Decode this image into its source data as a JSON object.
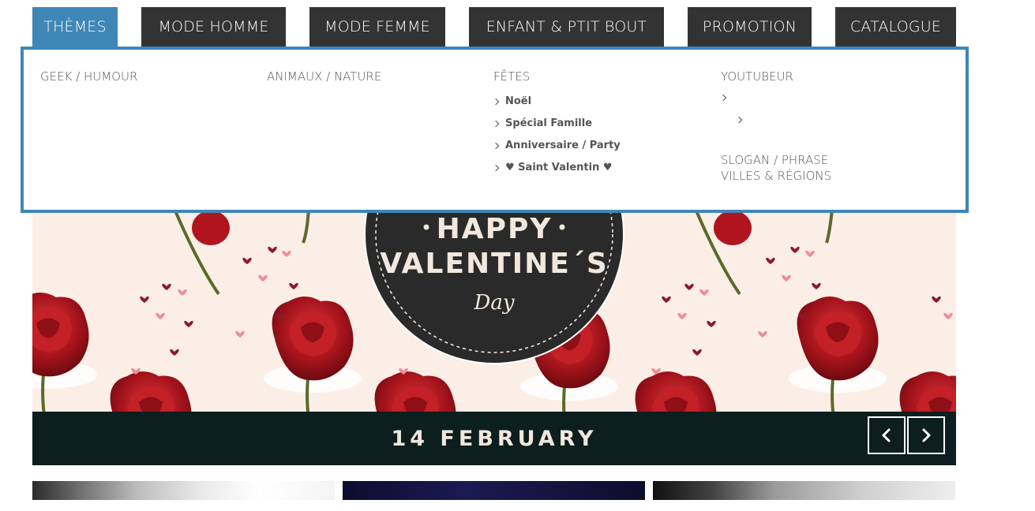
{
  "nav": {
    "tabs": [
      {
        "label": "THÈMES",
        "active": true
      },
      {
        "label": "MODE HOMME"
      },
      {
        "label": "MODE FEMME"
      },
      {
        "label": "ENFANT & PTIT BOUT"
      },
      {
        "label": "PROMOTION"
      },
      {
        "label": "CATALOGUE"
      }
    ]
  },
  "dropdown": {
    "columns": [
      {
        "heading": "GEEK / HUMOUR"
      },
      {
        "heading": "ANIMAUX / NATURE"
      },
      {
        "heading": "FÊTES",
        "items": [
          "Noël",
          "Spécial Famille",
          "Anniversaire / Party",
          "♥ Saint Valentin ♥"
        ]
      },
      {
        "heading": "YOUTUBEUR",
        "extra_headings": [
          "SLOGAN / PHRASE",
          "VILLES & RÉGIONS"
        ]
      }
    ]
  },
  "slider": {
    "badge_line1": "HAPPY",
    "badge_line2": "VALENTINE´S",
    "badge_line3": "Day",
    "caption": "14 FEBRUARY",
    "prev_icon": "chevron-left-icon",
    "next_icon": "chevron-right-icon"
  },
  "colors": {
    "accent": "#3e87b7",
    "nav_bg": "#333333",
    "caption_bg": "#0c1e1e",
    "banner_bg": "#fbeee6",
    "rose": "#b0151f"
  }
}
